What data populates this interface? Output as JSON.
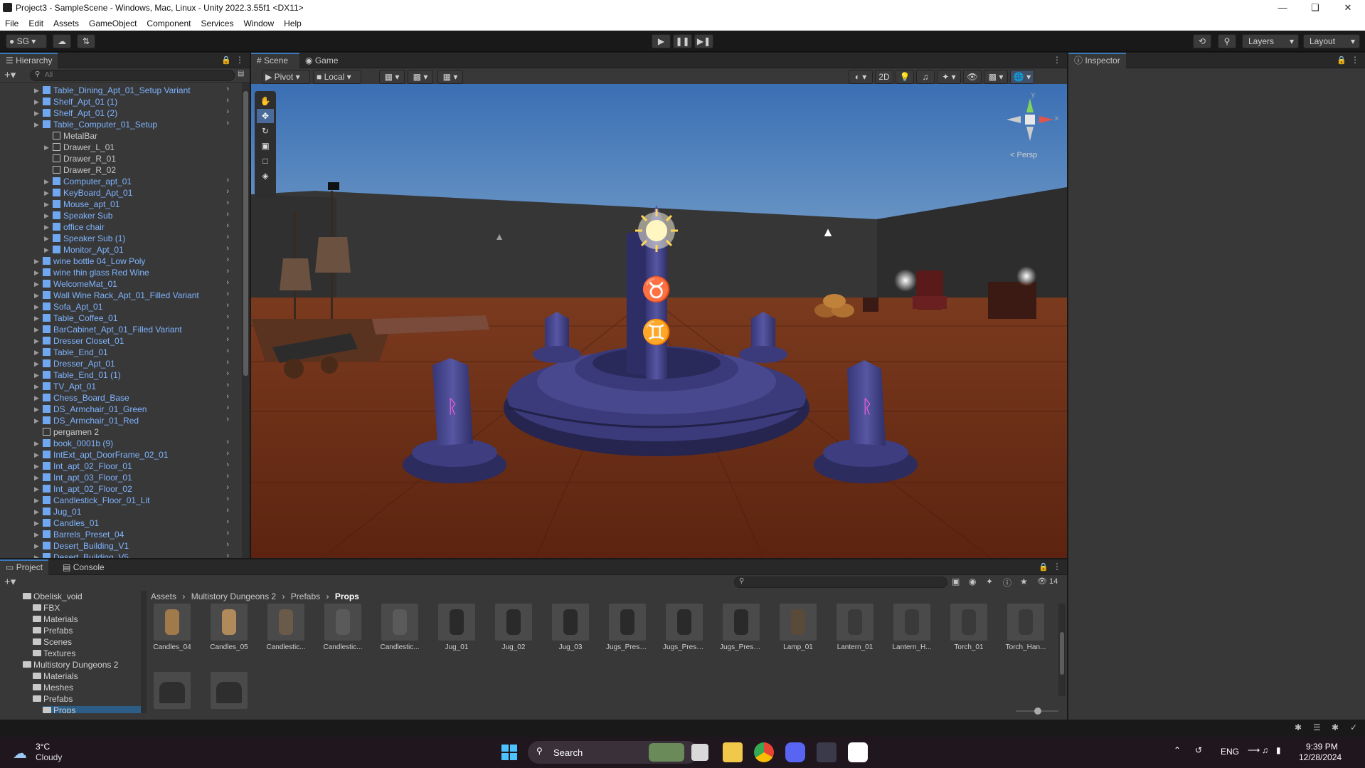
{
  "window": {
    "title": "Project3 - SampleScene - Windows, Mac, Linux - Unity 2022.3.55f1 <DX11>"
  },
  "menu": [
    "File",
    "Edit",
    "Assets",
    "GameObject",
    "Component",
    "Services",
    "Window",
    "Help"
  ],
  "toolbar": {
    "account": "SG",
    "layers": "Layers",
    "layout": "Layout"
  },
  "hierarchy": {
    "tab": "Hierarchy",
    "search_placeholder": "All",
    "items": [
      "Table_Dining_Apt_01_Setup Variant",
      "Shelf_Apt_01 (1)",
      "Shelf_Apt_01 (2)",
      "Table_Computer_01_Setup",
      "MetalBar",
      "Drawer_L_01",
      "Drawer_R_01",
      "Drawer_R_02",
      "Computer_apt_01",
      "KeyBoard_Apt_01",
      "Mouse_apt_01",
      "Speaker Sub",
      "office chair",
      "Speaker Sub (1)",
      "Monitor_Apt_01",
      "wine bottle 04_Low Poly",
      "wine thin glass Red Wine",
      "WelcomeMat_01",
      "Wall Wine Rack_Apt_01_Filled Variant",
      "Sofa_Apt_01",
      "Table_Coffee_01",
      "BarCabinet_Apt_01_Filled Variant",
      "Dresser Closet_01",
      "Table_End_01",
      "Dresser_Apt_01",
      "Table_End_01 (1)",
      "TV_Apt_01",
      "Chess_Board_Base",
      "DS_Armchair_01_Green",
      "DS_Armchair_01_Red",
      "pergamen 2",
      "book_0001b (9)",
      "IntExt_apt_DoorFrame_02_01",
      "Int_apt_02_Floor_01",
      "Int_apt_03_Floor_01",
      "Int_apt_02_Floor_02",
      "Candlestick_Floor_01_Lit",
      "Jug_01",
      "Candles_01",
      "Barrels_Preset_04",
      "Desert_Building_V1",
      "Desert_Building_V5"
    ]
  },
  "scene": {
    "tab_scene": "Scene",
    "tab_game": "Game",
    "pivot": "Pivot",
    "local": "Local",
    "mode_2d": "2D",
    "persp": "< Persp",
    "gizmo_y": "y",
    "gizmo_x": "x"
  },
  "inspector": {
    "tab": "Inspector"
  },
  "project": {
    "tab_project": "Project",
    "tab_console": "Console",
    "breadcrumb": [
      "Assets",
      "Multistory Dungeons 2",
      "Prefabs",
      "Props"
    ],
    "visible_count": "14",
    "tree": [
      {
        "label": "Obelisk_void",
        "indent": 0
      },
      {
        "label": "FBX",
        "indent": 1
      },
      {
        "label": "Materials",
        "indent": 1
      },
      {
        "label": "Prefabs",
        "indent": 1
      },
      {
        "label": "Scenes",
        "indent": 1
      },
      {
        "label": "Textures",
        "indent": 1
      },
      {
        "label": "Multistory Dungeons 2",
        "indent": 0
      },
      {
        "label": "Materials",
        "indent": 1
      },
      {
        "label": "Meshes",
        "indent": 1
      },
      {
        "label": "Prefabs",
        "indent": 1
      },
      {
        "label": "Props",
        "indent": 2
      }
    ],
    "assets": [
      "Candles_04",
      "Candles_05",
      "Candlestic...",
      "Candlestic...",
      "Candlestic...",
      "Jug_01",
      "Jug_02",
      "Jug_03",
      "Jugs_Prese...",
      "Jugs_Prese...",
      "Jugs_Prese...",
      "Lamp_01",
      "Lantern_01",
      "Lantern_H...",
      "Torch_01",
      "Torch_Han..."
    ]
  },
  "taskbar": {
    "weather_temp": "3°C",
    "weather_desc": "Cloudy",
    "search": "Search",
    "lang": "ENG",
    "time": "9:39 PM",
    "date": "12/28/2024"
  },
  "colors": {
    "accent": "#3a79bb",
    "prefab_blue": "#7fb4ff",
    "stone": "#4a4a8f",
    "rune": "#ff5fe0"
  }
}
